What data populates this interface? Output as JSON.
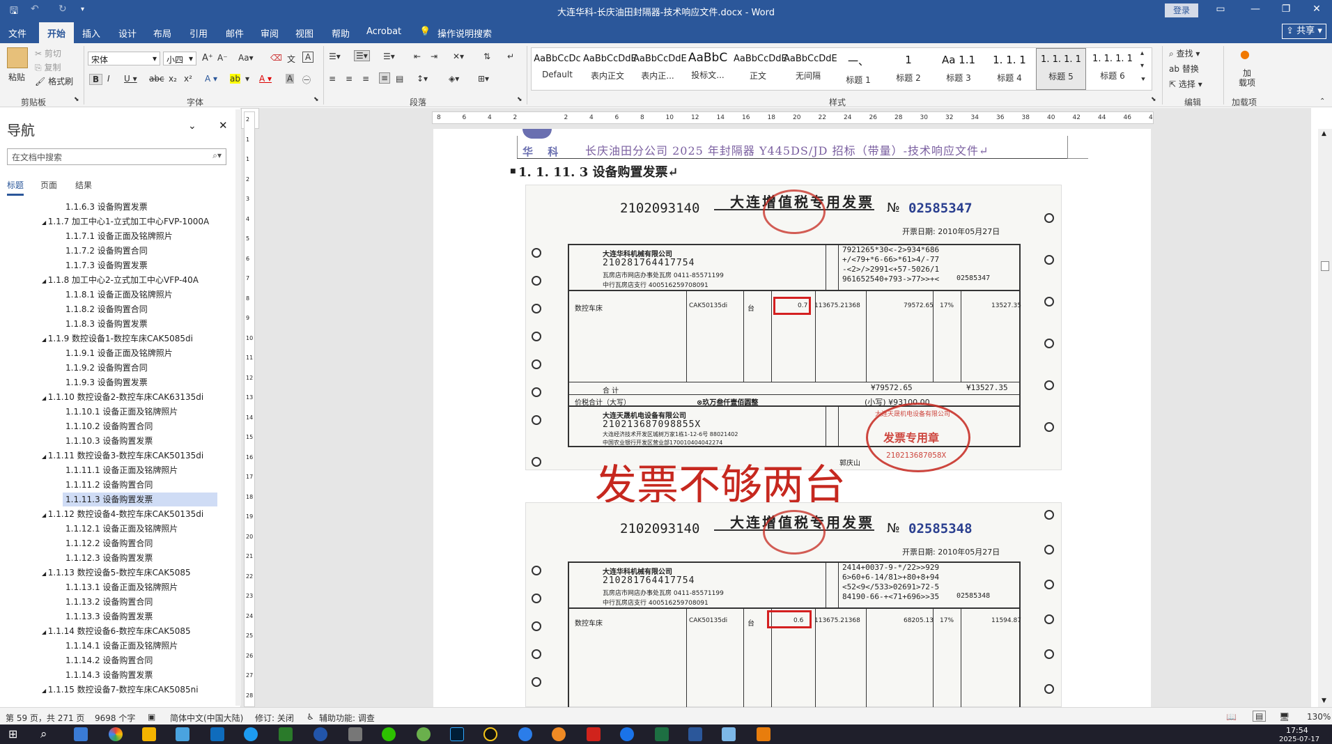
{
  "window": {
    "title": "大连华科-长庆油田封隔器-技术响应文件.docx  -  Word",
    "login_label": "登录",
    "share_label": "共享"
  },
  "ribbon_tabs": [
    "文件",
    "开始",
    "插入",
    "设计",
    "布局",
    "引用",
    "邮件",
    "审阅",
    "视图",
    "帮助",
    "Acrobat",
    "操作说明搜索"
  ],
  "clipboard": {
    "paste": "粘贴",
    "cut": "剪切",
    "copy": "复制",
    "format_painter": "格式刷",
    "group_label": "剪贴板"
  },
  "font": {
    "name": "宋体",
    "size": "小四",
    "group_label": "字体"
  },
  "paragraph": {
    "group_label": "段落"
  },
  "styles": {
    "group_label": "样式",
    "items": [
      {
        "preview": "AaBbCcDc",
        "name": "Default"
      },
      {
        "preview": "AaBbCcDdE",
        "name": "表内正文"
      },
      {
        "preview": "AaBbCcDdE",
        "name": "表内正..."
      },
      {
        "preview": "AaBbC",
        "name": "投标文..."
      },
      {
        "preview": "AaBbCcDdE",
        "name": "正文"
      },
      {
        "preview": "AaBbCcDdE",
        "name": "无间隔"
      },
      {
        "preview": "一、",
        "name": "标题 1"
      },
      {
        "preview": "1",
        "name": "标题 2"
      },
      {
        "preview": "Aa 1.1",
        "name": "标题 3"
      },
      {
        "preview": "1. 1. 1",
        "name": "标题 4"
      },
      {
        "preview": "1. 1. 1. 1",
        "name": "标题 5"
      },
      {
        "preview": "1. 1. 1. 1",
        "name": "标题 6"
      }
    ]
  },
  "editing": {
    "find": "查找",
    "replace": "替换",
    "select": "选择",
    "group_label": "编辑"
  },
  "addins": {
    "label": "加\n载项",
    "group_label": "加载项"
  },
  "nav": {
    "title": "导航",
    "search_placeholder": "在文档中搜索",
    "tabs": [
      "标题",
      "页面",
      "结果"
    ],
    "items": [
      {
        "level": 3,
        "text": "1.1.6.3 设备购置发票"
      },
      {
        "level": 2,
        "text": "1.1.7 加工中心1-立式加工中心FVP-1000A"
      },
      {
        "level": 3,
        "text": "1.1.7.1 设备正面及铭牌照片"
      },
      {
        "level": 3,
        "text": "1.1.7.2 设备购置合同"
      },
      {
        "level": 3,
        "text": "1.1.7.3 设备购置发票"
      },
      {
        "level": 2,
        "text": "1.1.8 加工中心2-立式加工中心VFP-40A"
      },
      {
        "level": 3,
        "text": "1.1.8.1 设备正面及铭牌照片"
      },
      {
        "level": 3,
        "text": "1.1.8.2 设备购置合同"
      },
      {
        "level": 3,
        "text": "1.1.8.3 设备购置发票"
      },
      {
        "level": 2,
        "text": "1.1.9 数控设备1-数控车床CAK5085di"
      },
      {
        "level": 3,
        "text": "1.1.9.1 设备正面及铭牌照片"
      },
      {
        "level": 3,
        "text": "1.1.9.2 设备购置合同"
      },
      {
        "level": 3,
        "text": "1.1.9.3 设备购置发票"
      },
      {
        "level": 2,
        "text": "1.1.10 数控设备2-数控车床CAK63135di"
      },
      {
        "level": 3,
        "text": "1.1.10.1 设备正面及铭牌照片"
      },
      {
        "level": 3,
        "text": "1.1.10.2 设备购置合同"
      },
      {
        "level": 3,
        "text": "1.1.10.3 设备购置发票"
      },
      {
        "level": 2,
        "text": "1.1.11 数控设备3-数控车床CAK50135di"
      },
      {
        "level": 3,
        "text": "1.1.11.1 设备正面及铭牌照片"
      },
      {
        "level": 3,
        "text": "1.1.11.2 设备购置合同"
      },
      {
        "level": 3,
        "text": "1.1.11.3 设备购置发票",
        "selected": true
      },
      {
        "level": 2,
        "text": "1.1.12 数控设备4-数控车床CAK50135di"
      },
      {
        "level": 3,
        "text": "1.1.12.1 设备正面及铭牌照片"
      },
      {
        "level": 3,
        "text": "1.1.12.2 设备购置合同"
      },
      {
        "level": 3,
        "text": "1.1.12.3 设备购置发票"
      },
      {
        "level": 2,
        "text": "1.1.13 数控设备5-数控车床CAK5085"
      },
      {
        "level": 3,
        "text": "1.1.13.1 设备正面及铭牌照片"
      },
      {
        "level": 3,
        "text": "1.1.13.2 设备购置合同"
      },
      {
        "level": 3,
        "text": "1.1.13.3 设备购置发票"
      },
      {
        "level": 2,
        "text": "1.1.14 数控设备6-数控车床CAK5085"
      },
      {
        "level": 3,
        "text": "1.1.14.1 设备正面及铭牌照片"
      },
      {
        "level": 3,
        "text": "1.1.14.2 设备购置合同"
      },
      {
        "level": 3,
        "text": "1.1.14.3 设备购置发票"
      },
      {
        "level": 2,
        "text": "1.1.15 数控设备7-数控车床CAK5085ni"
      }
    ]
  },
  "ruler_ticks": [
    "8",
    "6",
    "4",
    "2",
    "",
    "2",
    "4",
    "6",
    "8",
    "10",
    "12",
    "14",
    "16",
    "18",
    "20",
    "22",
    "24",
    "26",
    "28",
    "30",
    "32",
    "34",
    "36",
    "38",
    "40",
    "42",
    "44",
    "46",
    "48"
  ],
  "vruler_ticks": [
    "2",
    "1",
    "1",
    "2",
    "3",
    "4",
    "5",
    "6",
    "7",
    "8",
    "9",
    "10",
    "11",
    "12",
    "13",
    "14",
    "15",
    "16",
    "17",
    "18",
    "19",
    "20",
    "21",
    "22",
    "23",
    "24",
    "25",
    "26",
    "27",
    "28"
  ],
  "document": {
    "header_logo_text": "华 科",
    "header_text": "长庆油田分公司 2025 年封隔器 Y445DS/JD 招标（带量）-技术响应文件↵",
    "heading": "1. 1. 11. 3 设备购置发票↵",
    "annotation": "发票不够两台"
  },
  "invoices": [
    {
      "code": "2102093140",
      "title": "大连增值税专用发票",
      "no_label": "№",
      "number": "02585347",
      "date": "开票日期: 2010年05月27日",
      "buyer_name": "大连华科机械有限公司",
      "buyer_tax_id": "210281764417754",
      "buyer_addr": "瓦房店市网店办事处瓦房 0411-85571199",
      "buyer_bank": "中行瓦房店支行 400516259708091",
      "cipher": [
        "7921265*30<-2>934*686",
        "+/<79+*6-66>*61>4/-77",
        "-<2>/>2991<+57-5026/1",
        "961652540+793->77>>+<"
      ],
      "cipher_code": "02585347",
      "item": "数控车床",
      "model": "CAK50135di",
      "unit": "台",
      "qty": "0.7",
      "price": "113675.21368",
      "amount": "79572.65",
      "rate": "17%",
      "tax": "13527.35",
      "total_amount": "¥79572.65",
      "total_tax": "¥13527.35",
      "total_label": "合 计",
      "total_words_label": "价税合计（大写）",
      "total_words": "⊗玖万叁仟壹佰圆整",
      "total_small": "(小写) ¥93100.00",
      "seller_name": "大连天晟机电设备有限公司",
      "seller_tax_id": "210213687098855X",
      "seller_addr": "大连经济技术开发区城树万家1栋1-12-6号 88021402",
      "seller_bank": "中国农业银行开发区营业部170010404042274",
      "stamp": "发票专用章",
      "stamp_ring": "大连天晟机电设备有限公司",
      "stamp_id": "210213687058X",
      "issuer": "郭庆山"
    },
    {
      "code": "2102093140",
      "title": "大连增值税专用发票",
      "no_label": "№",
      "number": "02585348",
      "date": "开票日期: 2010年05月27日",
      "buyer_name": "大连华科机械有限公司",
      "buyer_tax_id": "210281764417754",
      "buyer_addr": "瓦房店市网店办事处瓦房 0411-85571199",
      "buyer_bank": "中行瓦房店支行 400516259708091",
      "cipher": [
        "2414+0037-9-*/22>>929",
        "6>60+6-14/81>+80+8+94",
        "<52<9</533>02691>72-5",
        "84190-66-+<71+696>>35"
      ],
      "cipher_code": "02585348",
      "item": "数控车床",
      "model": "CAK50135di",
      "unit": "台",
      "qty": "0.6",
      "price": "113675.21368",
      "amount": "68205.13",
      "rate": "17%",
      "tax": "11594.87"
    }
  ],
  "status": {
    "page": "第 59 页，共 271 页",
    "words": "9698 个字",
    "lang": "简体中文(中国大陆)",
    "track": "修订: 关闭",
    "access": "辅助功能: 调查",
    "zoom": "130%"
  },
  "taskbar": {
    "time": "17:54",
    "date": "2025-07-17"
  },
  "colors": {
    "word_blue": "#2b579a",
    "annotation_red": "#c6281f",
    "highlight_box": "#d42020",
    "nav_selected": "#cfdcf5"
  }
}
